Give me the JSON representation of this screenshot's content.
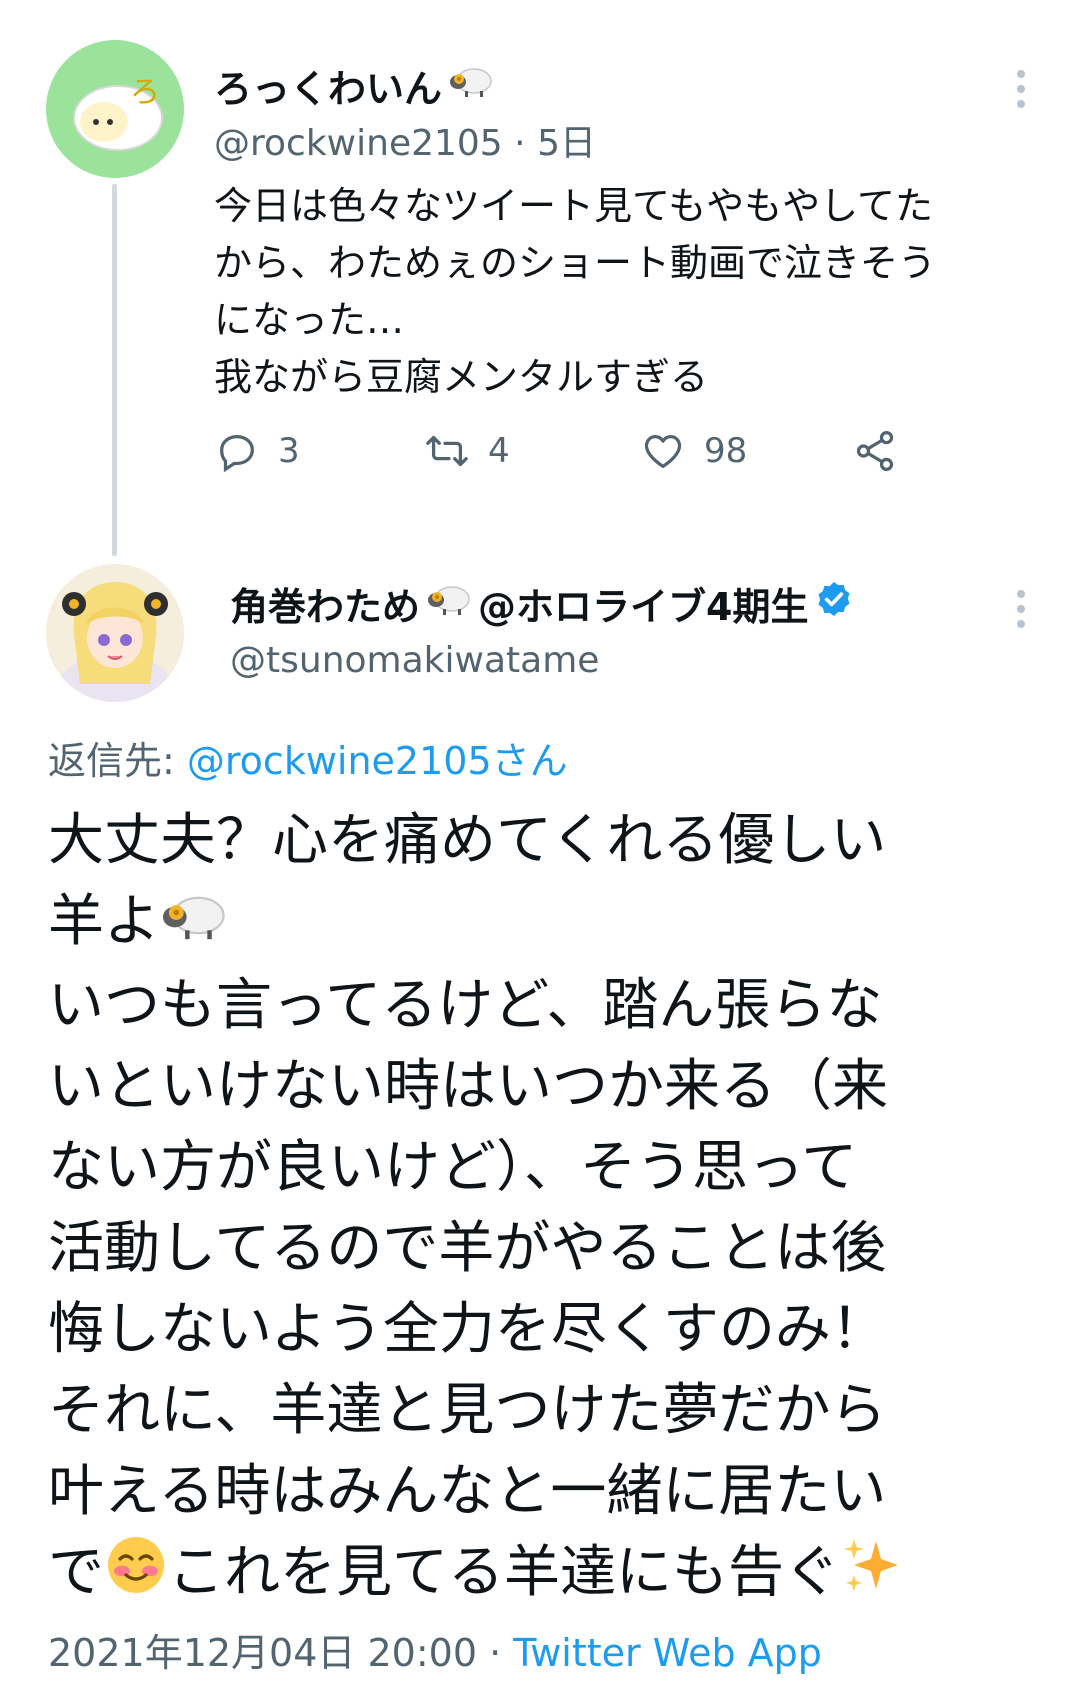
{
  "parent_tweet": {
    "display_name": "ろっくわいん",
    "handle": "@rockwine2105",
    "separator": "·",
    "time": "5日",
    "text_lines": [
      "今日は色々なツイート見てもやもやしてた",
      "から、わためぇのショート動画で泣きそう",
      "になった…",
      "我ながら豆腐メンタルすぎる"
    ],
    "reply_count": "3",
    "retweet_count": "4",
    "like_count": "98"
  },
  "main_tweet": {
    "display_name": "角巻わため",
    "display_name_suffix": "@ホロライブ4期生",
    "handle": "@tsunomakiwatame",
    "replying_label": "返信先: ",
    "replying_to": "@rockwine2105さん",
    "text_lines": [
      "大丈夫？心を痛めてくれる優しい",
      "羊よ",
      "いつも言ってるけど、踏ん張らな",
      "いといけない時はいつか来る（来",
      "ない方が良いけど）、そう思って",
      "活動してるので羊がやることは後",
      "悔しないよう全力を尽くすのみ！",
      "それに、羊達と見つけた夢だから",
      "叶える時はみんなと一緒に居たい",
      "で",
      "これを見てる羊達にも告ぐ"
    ],
    "timestamp": "2021年12月04日 20:00",
    "separator": "·",
    "source": "Twitter Web App"
  },
  "icons": [
    "sheep-emoji",
    "verified-badge-icon",
    "more-icon",
    "reply-icon",
    "retweet-icon",
    "like-icon",
    "share-icon",
    "smiling-face-emoji",
    "sparkles-emoji"
  ],
  "colors": {
    "link": "#1d9bf0",
    "muted": "#536471",
    "text": "#0f1419",
    "thread_line": "#cfd9de"
  }
}
